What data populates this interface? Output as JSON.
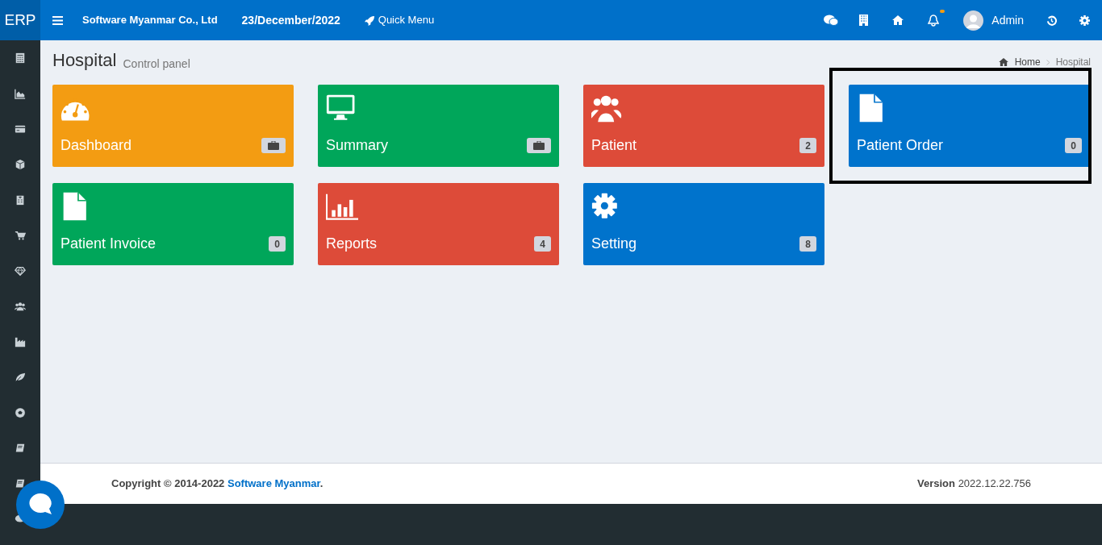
{
  "header": {
    "logo": "ERP",
    "company": "Software Myanmar Co., Ltd",
    "date": "23/December/2022",
    "quick_menu": "Quick Menu",
    "notification": true,
    "user": "Admin"
  },
  "page": {
    "title": "Hospital",
    "subtitle": "Control panel",
    "breadcrumb": [
      "Home",
      "Hospital"
    ]
  },
  "tiles": [
    {
      "label": "Dashboard",
      "kind": "gauge",
      "color": "#f39c12",
      "badge": {
        "kind": "briefcase"
      },
      "highlighted": false
    },
    {
      "label": "Summary",
      "kind": "monitor",
      "color": "#00a65a",
      "badge": {
        "kind": "briefcase"
      },
      "highlighted": false
    },
    {
      "label": "Patient",
      "kind": "users",
      "color": "#dd4b39",
      "badge": {
        "kind": "count",
        "text": "2"
      },
      "highlighted": false
    },
    {
      "label": "Patient Order",
      "kind": "file",
      "color": "#0073cc",
      "badge": {
        "kind": "count",
        "text": "0"
      },
      "highlighted": true
    },
    {
      "label": "Patient Invoice",
      "kind": "file",
      "color": "#00a65a",
      "badge": {
        "kind": "count",
        "text": "0"
      },
      "highlighted": false
    },
    {
      "label": "Reports",
      "kind": "chart",
      "color": "#dd4b39",
      "badge": {
        "kind": "count",
        "text": "4"
      },
      "highlighted": false
    },
    {
      "label": "Setting",
      "kind": "gear",
      "color": "#0073cc",
      "badge": {
        "kind": "count",
        "text": "8"
      },
      "highlighted": false
    }
  ],
  "footer": {
    "copyright": "Copyright © 2014-2022",
    "link": "Software Myanmar",
    "link_suffix": ".",
    "version_label": "Version",
    "version": "2022.12.22.756"
  }
}
